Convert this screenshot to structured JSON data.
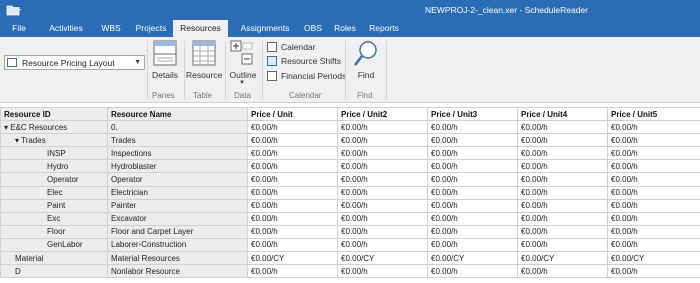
{
  "window": {
    "title": "NEWPROJ-2-_clean.xer - ScheduleReader"
  },
  "tabs": [
    {
      "label": "File"
    },
    {
      "label": "Activities"
    },
    {
      "label": "WBS"
    },
    {
      "label": "Projects"
    },
    {
      "label": "Resources",
      "active": true
    },
    {
      "label": "Assignments"
    },
    {
      "label": "OBS"
    },
    {
      "label": "Roles"
    },
    {
      "label": "Reports"
    }
  ],
  "ribbon": {
    "layout_value": "Resource Pricing Layout",
    "details_label": "Details",
    "resource_label": "Resource",
    "outline_label": "Outline",
    "calendar_label": "Calendar",
    "resource_shifts_label": "Resource Shifts",
    "financial_periods_label": "Financial Periods",
    "find_label": "Find",
    "group_panes": "Panes",
    "group_table": "Table",
    "group_data": "Data",
    "group_calendar": "Calendar",
    "group_find": "Find"
  },
  "grid": {
    "columns": [
      "Resource ID",
      "Resource Name",
      "Price / Unit",
      "Price / Unit2",
      "Price / Unit3",
      "Price / Unit4",
      "Price / Unit5"
    ],
    "rows": [
      {
        "id": "E&C Resources",
        "name": "0.",
        "p1": "€0.00/h",
        "p2": "€0.00/h",
        "p3": "€0.00/h",
        "p4": "€0.00/h",
        "p5": "€0.00/h"
      },
      {
        "id": "Trades",
        "name": "Trades",
        "p1": "€0.00/h",
        "p2": "€0.00/h",
        "p3": "€0.00/h",
        "p4": "€0.00/h",
        "p5": "€0.00/h"
      },
      {
        "id": "INSP",
        "name": "Inspections",
        "p1": "€0.00/h",
        "p2": "€0.00/h",
        "p3": "€0.00/h",
        "p4": "€0.00/h",
        "p5": "€0.00/h"
      },
      {
        "id": "Hydro",
        "name": "Hydroblaster",
        "p1": "€0.00/h",
        "p2": "€0.00/h",
        "p3": "€0.00/h",
        "p4": "€0.00/h",
        "p5": "€0.00/h"
      },
      {
        "id": "Operator",
        "name": "Operator",
        "p1": "€0.00/h",
        "p2": "€0.00/h",
        "p3": "€0.00/h",
        "p4": "€0.00/h",
        "p5": "€0.00/h"
      },
      {
        "id": "Elec",
        "name": "Electrician",
        "p1": "€0.00/h",
        "p2": "€0.00/h",
        "p3": "€0.00/h",
        "p4": "€0.00/h",
        "p5": "€0.00/h"
      },
      {
        "id": "Paint",
        "name": "Painter",
        "p1": "€0.00/h",
        "p2": "€0.00/h",
        "p3": "€0.00/h",
        "p4": "€0.00/h",
        "p5": "€0.00/h"
      },
      {
        "id": "Exc",
        "name": "Excavator",
        "p1": "€0.00/h",
        "p2": "€0.00/h",
        "p3": "€0.00/h",
        "p4": "€0.00/h",
        "p5": "€0.00/h"
      },
      {
        "id": "Floor",
        "name": "Floor and Carpet Layer",
        "p1": "€0.00/h",
        "p2": "€0.00/h",
        "p3": "€0.00/h",
        "p4": "€0.00/h",
        "p5": "€0.00/h"
      },
      {
        "id": "GenLabor",
        "name": "Laborer-Construction",
        "p1": "€0.00/h",
        "p2": "€0.00/h",
        "p3": "€0.00/h",
        "p4": "€0.00/h",
        "p5": "€0.00/h"
      },
      {
        "id": "Material",
        "name": "Material Resources",
        "p1": "€0.00/CY",
        "p2": "€0.00/CY",
        "p3": "€0.00/CY",
        "p4": "€0.00/CY",
        "p5": "€0.00/CY"
      },
      {
        "id": "D",
        "name": "Nonlabor Resource",
        "p1": "€0.00/h",
        "p2": "€0.00/h",
        "p3": "€0.00/h",
        "p4": "€0.00/h",
        "p5": "€0.00/h"
      }
    ]
  },
  "colors": {
    "accent": "#2b6cb7",
    "ribbon_bg": "#f0f0f0"
  }
}
